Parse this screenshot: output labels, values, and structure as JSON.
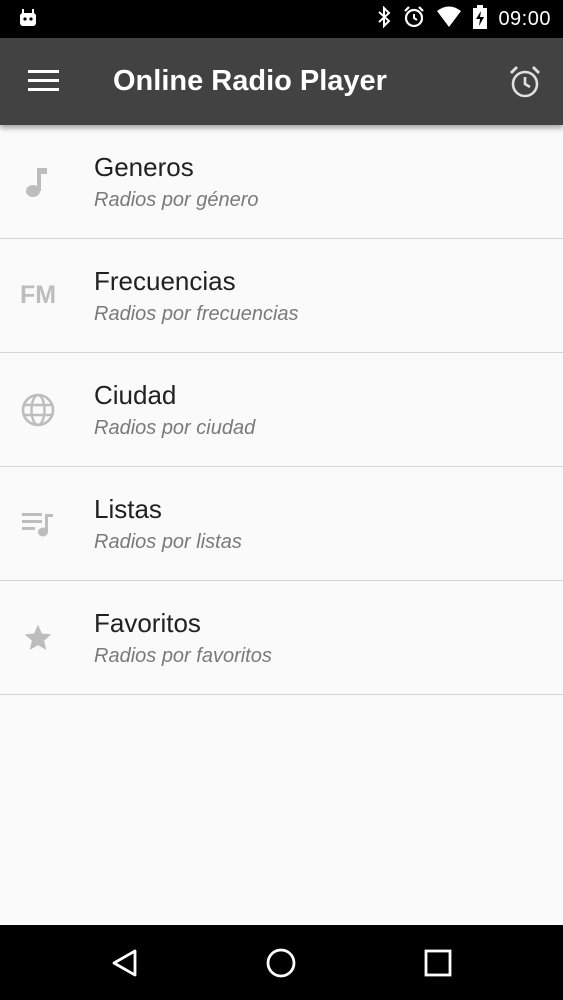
{
  "status_bar": {
    "time": "09:00",
    "icons": [
      "android-notification-icon",
      "bluetooth-icon",
      "alarm-status-icon",
      "wifi-icon",
      "battery-charging-icon"
    ]
  },
  "app_bar": {
    "title": "Online Radio Player",
    "left_icon": "menu-icon",
    "right_icon": "alarm-clock-icon"
  },
  "list": {
    "items": [
      {
        "title": "Generos",
        "subtitle": "Radios por género",
        "icon": "music-note-icon"
      },
      {
        "title": "Frecuencias",
        "subtitle": "Radios por frecuencias",
        "icon": "fm-icon",
        "icon_text": "FM"
      },
      {
        "title": "Ciudad",
        "subtitle": "Radios por ciudad",
        "icon": "globe-icon"
      },
      {
        "title": "Listas",
        "subtitle": "Radios por listas",
        "icon": "playlist-icon"
      },
      {
        "title": "Favoritos",
        "subtitle": "Radios por favoritos",
        "icon": "star-icon"
      }
    ]
  },
  "nav_bar": {
    "buttons": [
      "back-icon",
      "home-icon",
      "recents-icon"
    ]
  },
  "colors": {
    "app_bar": "#424242",
    "background": "#fafafa",
    "icon": "#bdbdbd",
    "title_text": "#212121",
    "subtitle_text": "#7a7a7a"
  }
}
